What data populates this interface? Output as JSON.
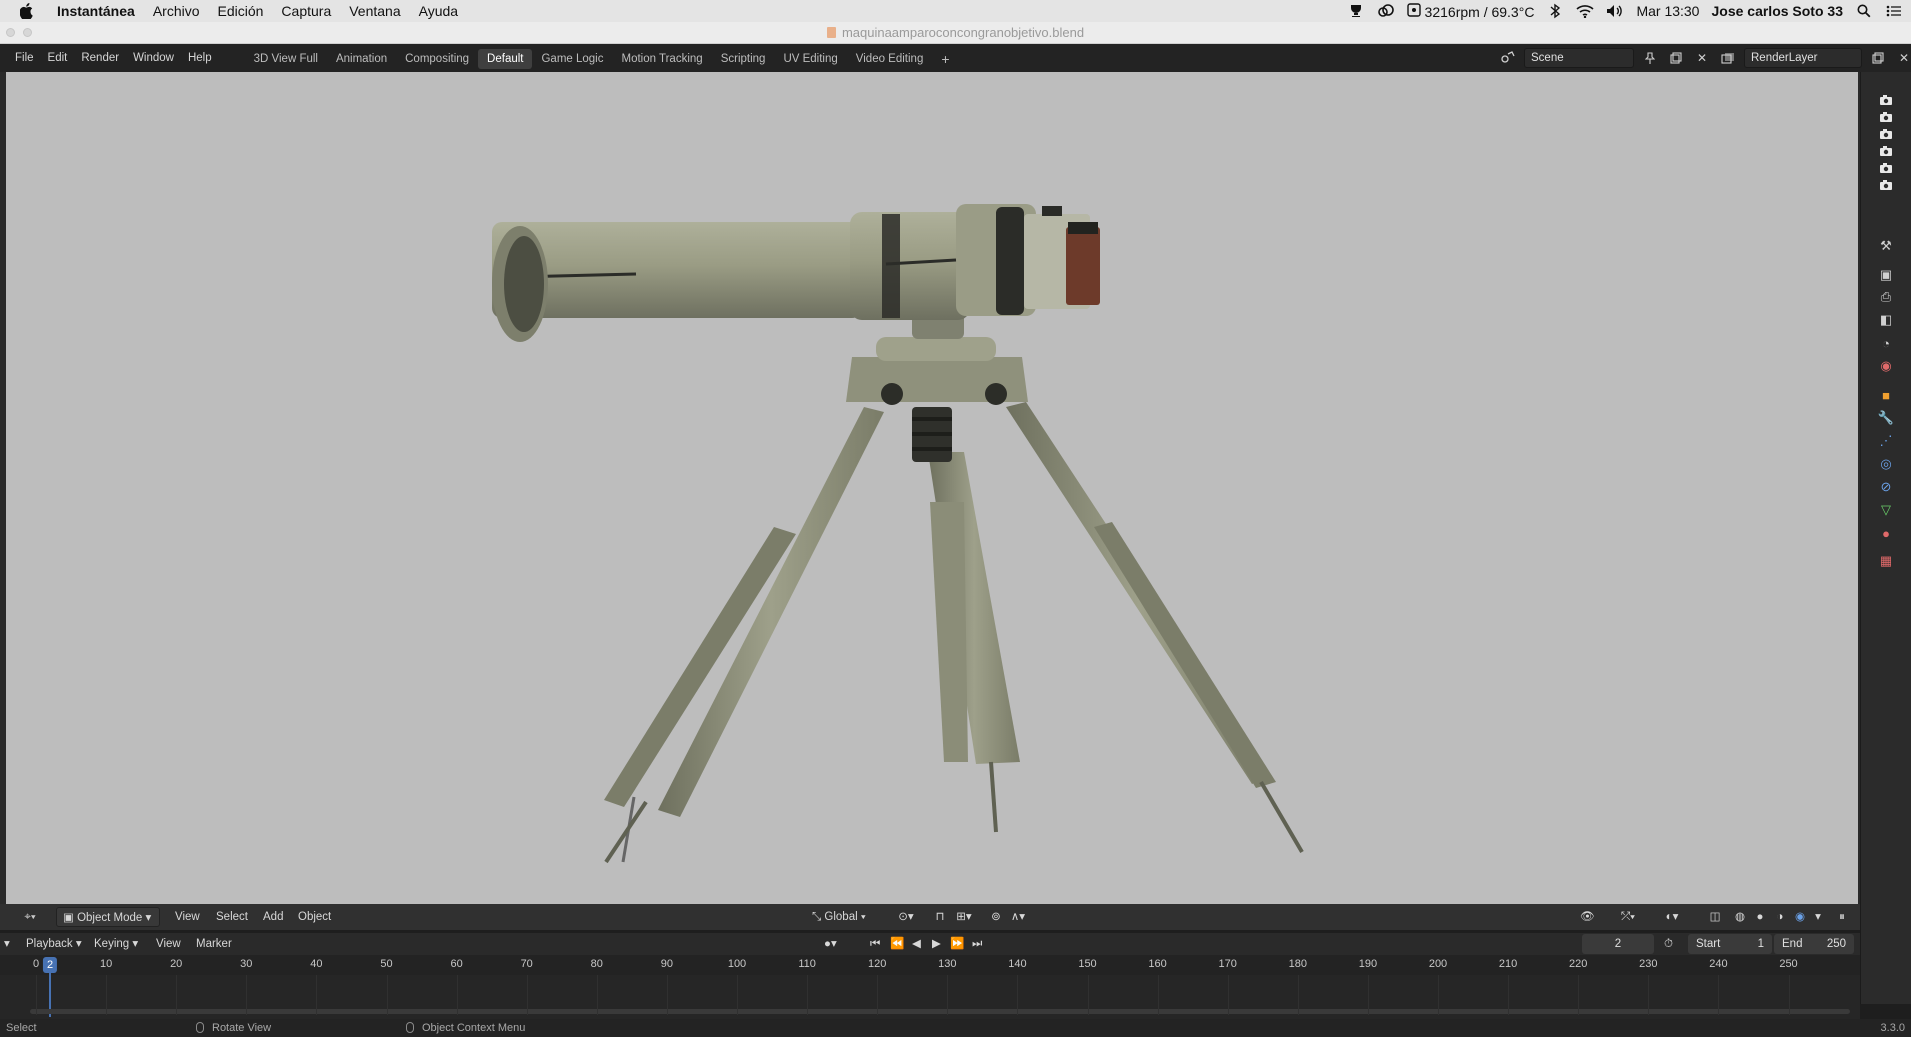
{
  "mac_menu": {
    "app": "Instantánea",
    "items": [
      "Archivo",
      "Edición",
      "Captura",
      "Ventana",
      "Ayuda"
    ],
    "status": {
      "fan": "3216rpm / 69.3°C",
      "clock": "Mar 13:30",
      "user": "Jose carlos Soto 33"
    }
  },
  "window": {
    "title": "maquinaamparoconcongranobjetivo.blend"
  },
  "topbar": {
    "menus": [
      "File",
      "Edit",
      "Render",
      "Window",
      "Help"
    ],
    "workspaces": [
      "3D View Full",
      "Animation",
      "Compositing",
      "Default",
      "Game Logic",
      "Motion Tracking",
      "Scripting",
      "UV Editing",
      "Video Editing"
    ],
    "active_workspace": "Default",
    "add_workspace": "+",
    "scene_name": "Scene",
    "render_layer": "RenderLayer"
  },
  "viewport_header": {
    "mode": "Object Mode",
    "menus": [
      "View",
      "Select",
      "Add",
      "Object"
    ],
    "orientation": "Global"
  },
  "timeline_header": {
    "menus": [
      "Playback",
      "Keying",
      "View",
      "Marker"
    ],
    "current_frame": "2",
    "start_label": "Start",
    "start_value": "1",
    "end_label": "End",
    "end_value": "250"
  },
  "timeline": {
    "ruler_labels": [
      "0",
      "10",
      "20",
      "30",
      "40",
      "50",
      "60",
      "70",
      "80",
      "90",
      "100",
      "110",
      "120",
      "130",
      "140",
      "150",
      "160",
      "170",
      "180",
      "190",
      "200",
      "210",
      "220",
      "230",
      "240",
      "250"
    ],
    "playhead_frame": "2"
  },
  "statusbar": {
    "select": "Select",
    "rotate": "Rotate View",
    "context": "Object Context Menu",
    "version": "3.3.0"
  },
  "colors": {
    "accent": "#4772b3",
    "viewport_bg": "#bdbdbd",
    "panel_bg": "#2b2b2b"
  }
}
